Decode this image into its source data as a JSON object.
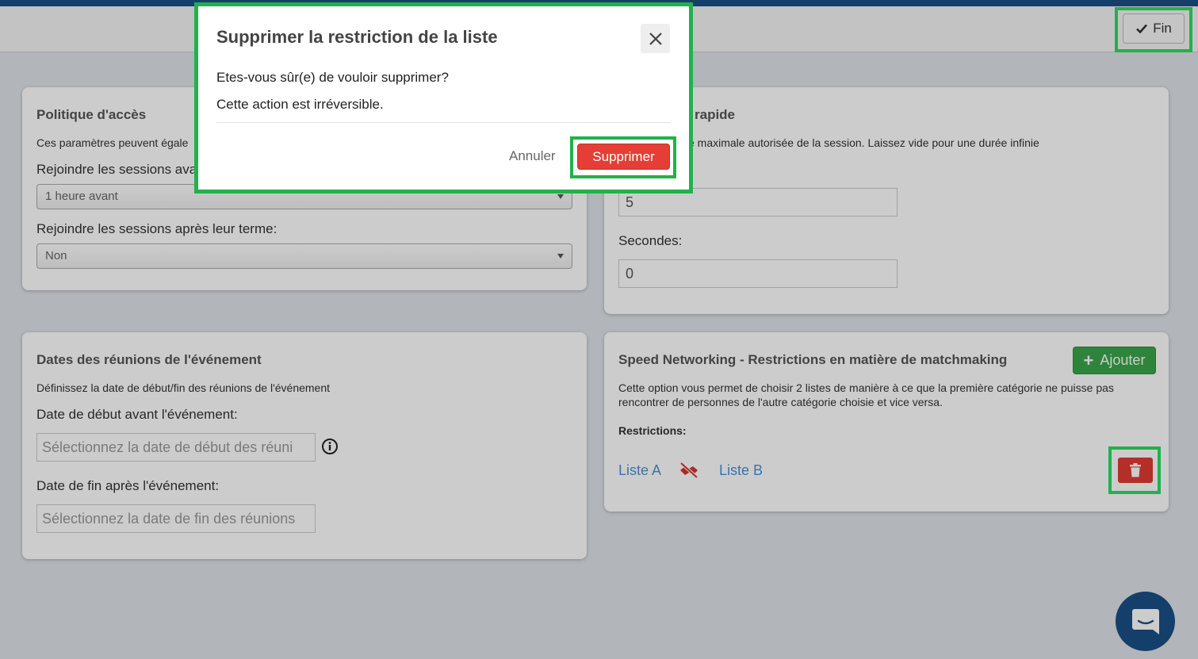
{
  "header": {
    "fin_label": "Fin"
  },
  "card_access": {
    "title": "Politique d'accès",
    "desc": "Ces paramètres peuvent égale",
    "join_before_label": "Rejoindre les sessions avan",
    "join_before_value": "1 heure avant",
    "join_after_label": "Rejoindre les sessions après leur terme:",
    "join_after_value": "Non"
  },
  "card_rapid": {
    "title": "rapide",
    "desc": "e maximale autorisée de la session. Laissez vide pour une durée infinie",
    "minutes_value": "5",
    "seconds_label": "Secondes:",
    "seconds_value": "0"
  },
  "card_dates": {
    "title": "Dates des réunions de l'événement",
    "desc": "Définissez la date de début/fin des réunions de l'événement",
    "start_label": "Date de début avant l'événement:",
    "start_placeholder": "Sélectionnez la date de début des réuni",
    "end_label": "Date de fin après l'événement:",
    "end_placeholder": "Sélectionnez la date de fin des réunions"
  },
  "card_speed": {
    "title": "Speed Networking - Restrictions en matière de matchmaking",
    "add_label": "Ajouter",
    "desc_line1": "Cette option vous permet de choisir 2 listes de manière à ce que la première catégorie ne puisse pas",
    "desc_line2": "rencontrer de personnes de l'autre catégorie choisie et vice versa.",
    "restrictions_label": "Restrictions:",
    "list_a": "Liste A",
    "list_b": "Liste B"
  },
  "modal": {
    "title": "Supprimer la restriction de la liste",
    "line1": "Etes-vous sûr(e) de vouloir supprimer?",
    "line2": "Cette action est irréversible.",
    "cancel_label": "Annuler",
    "confirm_label": "Supprimer"
  },
  "colors": {
    "danger": "#e53e36",
    "success": "#3aa54a",
    "highlight": "#22b14c",
    "brand": "#1a4f86"
  }
}
